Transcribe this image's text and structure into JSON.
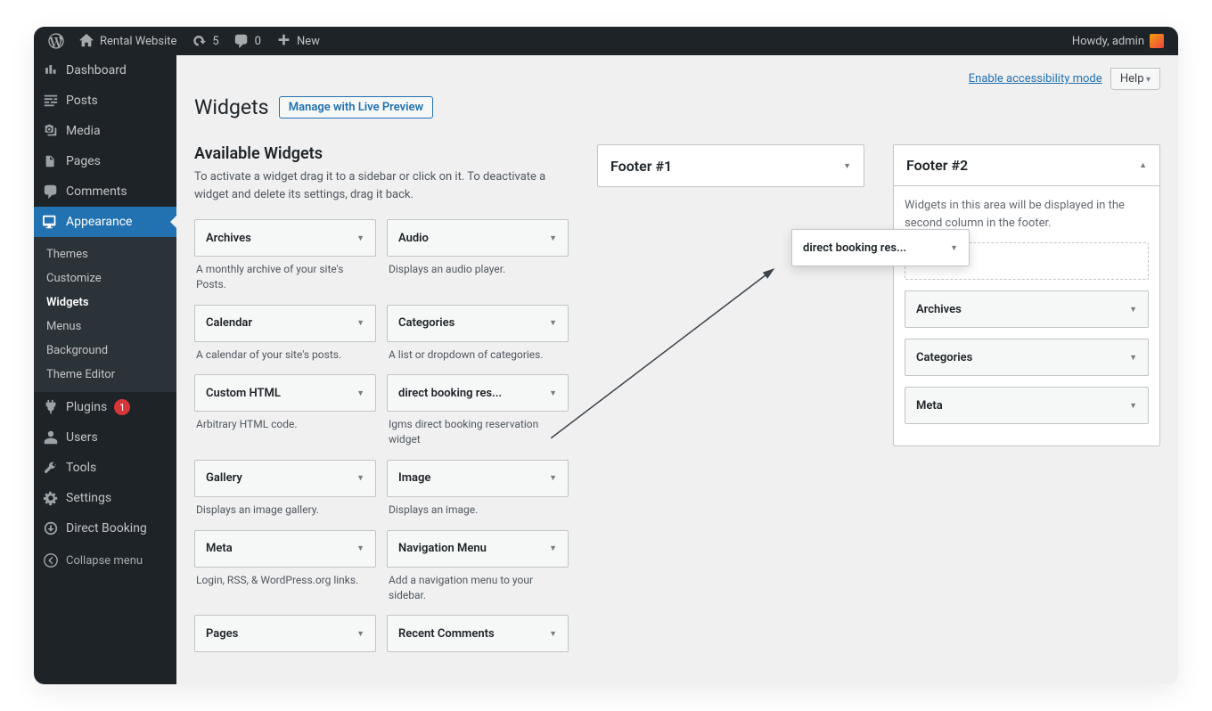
{
  "adminbar": {
    "site_name": "Rental Website",
    "updates_count": "5",
    "comments_count": "0",
    "new_label": "New",
    "howdy": "Howdy, admin"
  },
  "sidebar": {
    "items": [
      {
        "label": "Dashboard"
      },
      {
        "label": "Posts"
      },
      {
        "label": "Media"
      },
      {
        "label": "Pages"
      },
      {
        "label": "Comments"
      },
      {
        "label": "Appearance"
      },
      {
        "label": "Plugins",
        "badge": "1"
      },
      {
        "label": "Users"
      },
      {
        "label": "Tools"
      },
      {
        "label": "Settings"
      },
      {
        "label": "Direct Booking"
      }
    ],
    "appearance_submenu": [
      "Themes",
      "Customize",
      "Widgets",
      "Menus",
      "Background",
      "Theme Editor"
    ],
    "collapse_label": "Collapse menu"
  },
  "page": {
    "title": "Widgets",
    "title_action": "Manage with Live Preview",
    "accessibility_link": "Enable accessibility mode",
    "help_label": "Help"
  },
  "available": {
    "title": "Available Widgets",
    "desc": "To activate a widget drag it to a sidebar or click on it. To deactivate a widget and delete its settings, drag it back.",
    "widgets": [
      {
        "title": "Archives",
        "desc": "A monthly archive of your site's Posts."
      },
      {
        "title": "Audio",
        "desc": "Displays an audio player."
      },
      {
        "title": "Calendar",
        "desc": "A calendar of your site's posts."
      },
      {
        "title": "Categories",
        "desc": "A list or dropdown of categories."
      },
      {
        "title": "Custom HTML",
        "desc": "Arbitrary HTML code."
      },
      {
        "title": "direct booking res...",
        "desc": "Igms direct booking reservation widget"
      },
      {
        "title": "Gallery",
        "desc": "Displays an image gallery."
      },
      {
        "title": "Image",
        "desc": "Displays an image."
      },
      {
        "title": "Meta",
        "desc": "Login, RSS, & WordPress.org links."
      },
      {
        "title": "Navigation Menu",
        "desc": "Add a navigation menu to your sidebar."
      },
      {
        "title": "Pages",
        "desc": ""
      },
      {
        "title": "Recent Comments",
        "desc": ""
      }
    ]
  },
  "footer1": {
    "title": "Footer #1"
  },
  "footer2": {
    "title": "Footer #2",
    "desc": "Widgets in this area will be displayed in the second column in the footer.",
    "dragging_title": "direct booking res...",
    "placed": [
      "Archives",
      "Categories",
      "Meta"
    ]
  }
}
